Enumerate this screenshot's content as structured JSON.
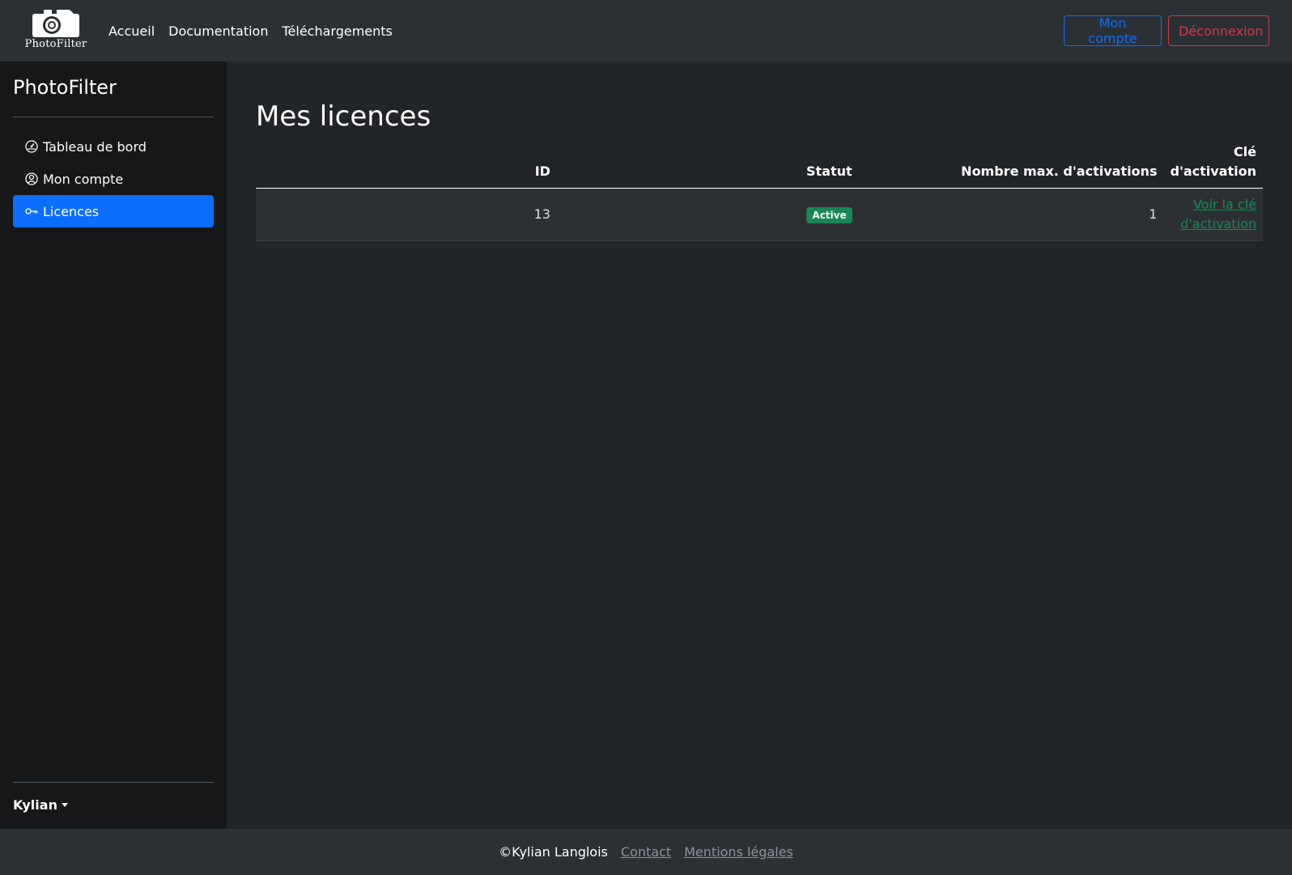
{
  "navbar": {
    "brand_name": "PhotoFilter",
    "links": [
      "Accueil",
      "Documentation",
      "Téléchargements"
    ],
    "account_button": "Mon compte",
    "logout_button": "Déconnexion",
    "colors": {
      "account": "#0d6efd",
      "logout": "#dc3545"
    }
  },
  "sidebar": {
    "title": "PhotoFilter",
    "items": [
      {
        "label": "Tableau de bord",
        "icon": "dashboard-icon",
        "active": false
      },
      {
        "label": "Mon compte",
        "icon": "user-circle-icon",
        "active": false
      },
      {
        "label": "Licences",
        "icon": "key-icon",
        "active": true
      }
    ],
    "user_name": "Kylian",
    "active_color": "#0d6efd"
  },
  "main": {
    "title": "Mes licences",
    "table": {
      "headers": [
        "ID",
        "Statut",
        "Nombre max. d'activations",
        "Clé d'activation"
      ],
      "rows": [
        {
          "id": "13",
          "status": "Active",
          "max_activations": "1",
          "key_link": "Voir la clé d'activation"
        }
      ],
      "status_color": "#198754"
    }
  },
  "footer": {
    "copyright": "©Kylian Langlois",
    "links": [
      "Contact",
      "Mentions légales"
    ]
  }
}
